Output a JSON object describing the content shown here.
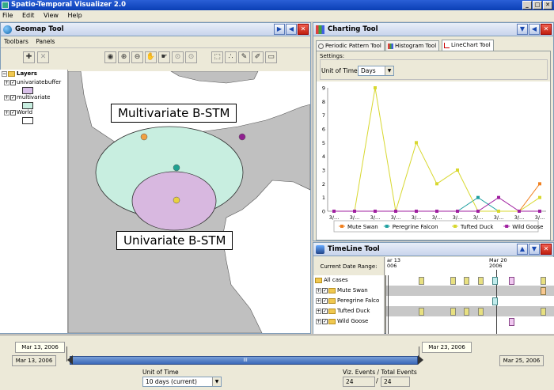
{
  "app": {
    "title": "Spatio-Temporal Visualizer 2.0"
  },
  "menu": [
    "File",
    "Edit",
    "View",
    "Help"
  ],
  "geomap": {
    "title": "Geomap Tool",
    "menus": [
      "Toolbars",
      "Panels"
    ],
    "layers_title": "Layers",
    "layers": [
      {
        "name": "univariatebuffer",
        "checked": true,
        "color": "#d8c0e8"
      },
      {
        "name": "multivariate",
        "checked": true,
        "color": "#c8eee0"
      },
      {
        "name": "World",
        "checked": true,
        "color": "#ffffff"
      }
    ],
    "label_multivariate": "Multivariate B-STM",
    "label_univariate": "Univariate B-STM",
    "colors": {
      "land": "#c0c0c0",
      "multivariate": "#c8eee0",
      "univariate": "#d8b8e0"
    }
  },
  "charting": {
    "title": "Charting Tool",
    "tabs": [
      "Periodic Pattern Tool",
      "Histogram Tool",
      "LineChart Tool"
    ],
    "active_tab": "LineChart Tool",
    "settings_label": "Settings:",
    "unit_label": "Unit of Time:",
    "unit_value": "Days"
  },
  "chart_data": {
    "type": "line",
    "categories": [
      "3/...",
      "3/...",
      "3/...",
      "3/...",
      "3/...",
      "3/...",
      "3/...",
      "3/...",
      "3/...",
      "3/...",
      "3/..."
    ],
    "ylim": [
      0,
      9
    ],
    "yticks": [
      "0",
      "1",
      "2",
      "3",
      "4",
      "5",
      "6",
      "7",
      "8",
      "9"
    ],
    "series": [
      {
        "name": "Mute Swan",
        "color": "#f08020",
        "values": [
          0,
          0,
          0,
          0,
          0,
          0,
          0,
          0,
          0,
          0,
          2
        ]
      },
      {
        "name": "Peregrine Falcon",
        "color": "#20a0a0",
        "values": [
          0,
          0,
          0,
          0,
          0,
          0,
          0,
          1,
          0,
          0,
          0
        ]
      },
      {
        "name": "Tufted Duck",
        "color": "#d8d830",
        "values": [
          0,
          0,
          9,
          0,
          5,
          2,
          3,
          0,
          0,
          0,
          1
        ]
      },
      {
        "name": "Wild Goose",
        "color": "#a020a0",
        "values": [
          0,
          0,
          0,
          0,
          0,
          0,
          0,
          0,
          1,
          0,
          0
        ]
      }
    ]
  },
  "timeline": {
    "title": "TimeLine Tool",
    "range_label": "Current Date Range:",
    "date_a": "ar 13",
    "date_a_year": "006",
    "date_b": "Mar 20",
    "date_b_year": "2006",
    "tree": [
      "All cases",
      "Mute Swan",
      "Peregrine Falco",
      "Tufted Duck",
      "Wild Goose"
    ]
  },
  "bottom": {
    "start_top": "Mar 13, 2006",
    "end_top": "Mar 23, 2006",
    "start_bottom": "Mar 13, 2006",
    "end_bottom": "Mar 25, 2006",
    "slider_grip": "III",
    "unit_label": "Unit of Time",
    "unit_value": "10 days (current)",
    "events_label": "Viz. Events / Total Events",
    "viz_events": "24",
    "sep": "/",
    "total_events": "24"
  }
}
